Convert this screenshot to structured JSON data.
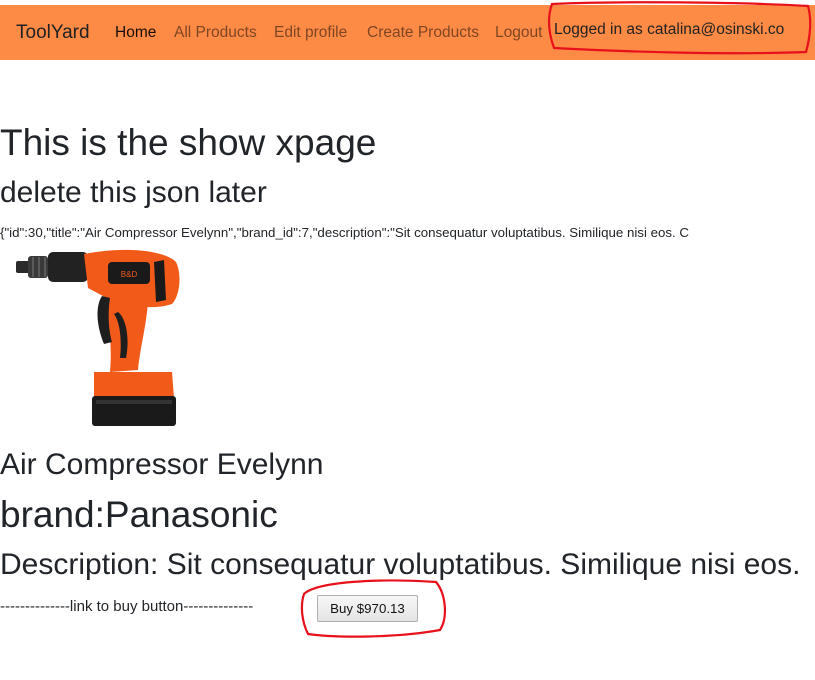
{
  "nav": {
    "brand": "ToolYard",
    "links": [
      {
        "label": "Home",
        "active": true
      },
      {
        "label": "All Products",
        "active": false
      },
      {
        "label": "Edit profile",
        "active": false
      },
      {
        "label": "Create Products",
        "active": false
      },
      {
        "label": "Logout",
        "active": false
      }
    ],
    "logged_in_text": "Logged in as catalina@osinski.co"
  },
  "page": {
    "heading": "This is the show xpage",
    "subheading": "delete this json later",
    "json_dump": "{\"id\":30,\"title\":\"Air Compressor Evelynn\",\"brand_id\":7,\"description\":\"Sit consequatur voluptatibus. Similique nisi eos. C"
  },
  "product": {
    "image_icon": "cordless-drill-icon",
    "title": "Air Compressor Evelynn",
    "brand_text": "brand:Panasonic",
    "description_text": "Description: Sit consequatur voluptatibus. Similique nisi eos.",
    "link_text": "--------------link to buy button--------------",
    "buy_label": "Buy $970.13"
  },
  "colors": {
    "navbar": "#fd8a45",
    "annotation": "#e8101a"
  }
}
